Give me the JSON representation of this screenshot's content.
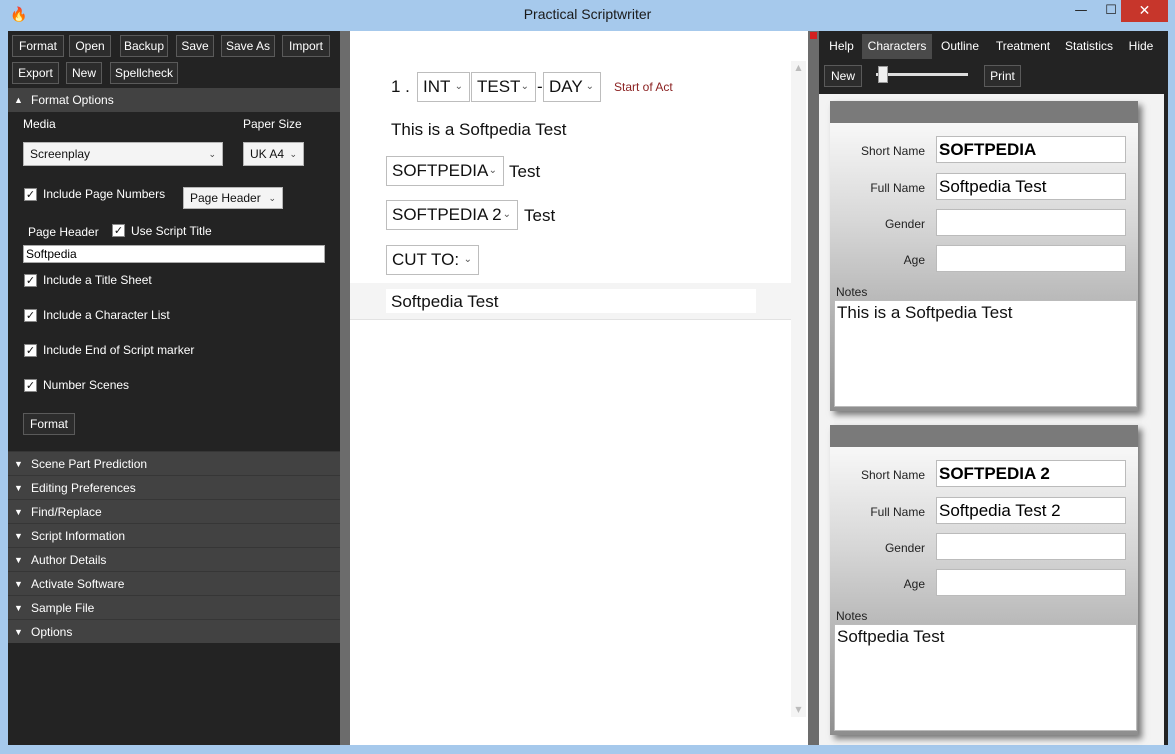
{
  "window": {
    "title": "Practical Scriptwriter",
    "minimize": "—",
    "maximize": "☐",
    "close": "✕"
  },
  "toolbar": {
    "format": "Format",
    "open": "Open",
    "backup": "Backup",
    "save": "Save",
    "save_as": "Save As",
    "import": "Import",
    "export": "Export",
    "new": "New",
    "spellcheck": "Spellcheck"
  },
  "format_options": {
    "header": "Format Options",
    "media_label": "Media",
    "media_value": "Screenplay",
    "paper_size_label": "Paper Size",
    "paper_size_value": "UK A4",
    "include_page_numbers": "Include Page Numbers",
    "page_numbers_position": "Page Header",
    "page_header_label": "Page Header",
    "use_script_title": "Use Script Title",
    "page_header_value": "Softpedia",
    "include_title_sheet": "Include a Title Sheet",
    "include_character_list": "Include a Character List",
    "include_end_marker": "Include End of Script marker",
    "number_scenes": "Number Scenes",
    "format_button": "Format"
  },
  "sections": [
    "Scene Part Prediction",
    "Editing Preferences",
    "Find/Replace",
    "Script Information",
    "Author Details",
    "Activate Software",
    "Sample File",
    "Options"
  ],
  "editor": {
    "scene_number": "1 .",
    "int_ext": "INT",
    "location": "TEST",
    "separator": "-",
    "time": "DAY",
    "start_of_act": "Start of Act",
    "action": "This is a Softpedia Test",
    "char1": "SOFTPEDIA",
    "dialog1": "Test",
    "char2": "SOFTPEDIA 2",
    "dialog2": "Test",
    "transition": "CUT TO:",
    "current_line": "Softpedia Test"
  },
  "right_tabs": [
    "Help",
    "Characters",
    "Outline",
    "Treatment",
    "Statistics",
    "Hide"
  ],
  "right_toolbar": {
    "new": "New",
    "print": "Print",
    "zoom_level": 0.05
  },
  "character_labels": {
    "short_name": "Short Name",
    "full_name": "Full Name",
    "gender": "Gender",
    "age": "Age",
    "notes": "Notes"
  },
  "characters": [
    {
      "short_name": "SOFTPEDIA",
      "full_name": "Softpedia Test",
      "gender": "",
      "age": "",
      "notes": "This is a Softpedia Test"
    },
    {
      "short_name": "SOFTPEDIA 2",
      "full_name": "Softpedia Test 2",
      "gender": "",
      "age": "",
      "notes": "Softpedia Test"
    }
  ],
  "colors": {
    "window_frame": "#a6c9ec",
    "dark_panel": "#232323",
    "section_header": "#424242",
    "close_button": "#c7362b",
    "start_of_act": "#8b2222"
  }
}
